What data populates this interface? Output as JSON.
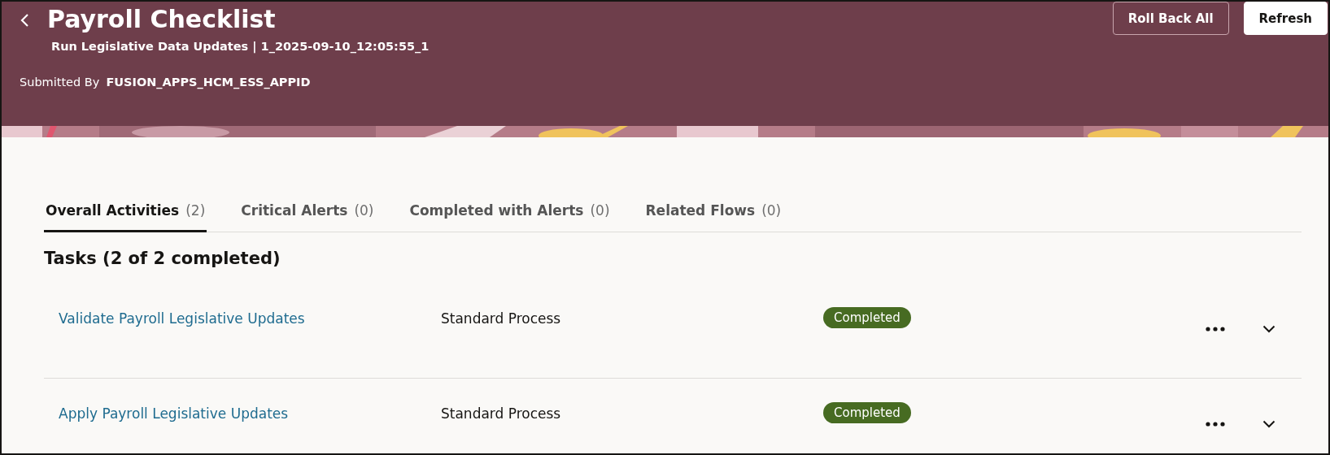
{
  "header": {
    "title": "Payroll Checklist",
    "subtitle": "Run Legislative Data Updates | 1_2025-09-10_12:05:55_1",
    "submitted_label": "Submitted By",
    "submitted_value": "FUSION_APPS_HCM_ESS_APPID",
    "buttons": [
      {
        "label": "Roll Back All",
        "kind": "outline"
      },
      {
        "label": "Refresh",
        "kind": "solid"
      }
    ]
  },
  "tabs": [
    {
      "label": "Overall Activities",
      "count": "(2)",
      "selected": true
    },
    {
      "label": "Critical Alerts",
      "count": "(0)",
      "selected": false
    },
    {
      "label": "Completed with Alerts",
      "count": "(0)",
      "selected": false
    },
    {
      "label": "Related Flows",
      "count": "(0)",
      "selected": false
    }
  ],
  "tasks": {
    "heading": "Tasks (2 of 2 completed)",
    "rows": [
      {
        "name": "Validate Payroll Legislative Updates",
        "type": "Standard Process",
        "status": "Completed"
      },
      {
        "name": "Apply Payroll Legislative Updates",
        "type": "Standard Process",
        "status": "Completed"
      }
    ]
  }
}
